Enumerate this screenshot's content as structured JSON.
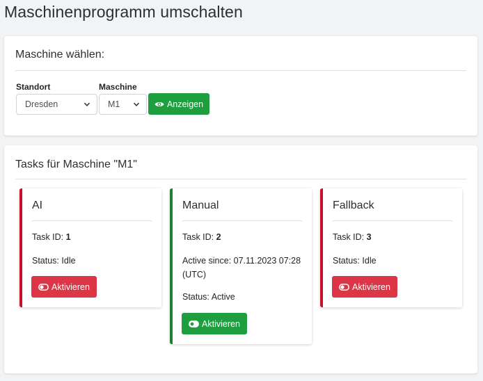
{
  "page": {
    "title": "Maschinenprogramm umschalten"
  },
  "selection": {
    "heading": "Maschine wählen:",
    "location_label": "Standort",
    "location_value": "Dresden",
    "machine_label": "Maschine",
    "machine_value": "M1",
    "show_button": "Anzeigen"
  },
  "tasks": {
    "heading": "Tasks für Maschine \"M1\"",
    "task_id_label": "Task ID:",
    "status_label": "Status:",
    "items": [
      {
        "name": "AI",
        "id": "1",
        "status": "Idle",
        "active_since": "",
        "button": "Aktivieren"
      },
      {
        "name": "Manual",
        "id": "2",
        "status": "Active",
        "active_since": "Active since: 07.11.2023 07:28 (UTC)",
        "button": "Aktivieren"
      },
      {
        "name": "Fallback",
        "id": "3",
        "status": "Idle",
        "active_since": "",
        "button": "Aktivieren"
      }
    ]
  },
  "colors": {
    "success": "#1e9e3f",
    "danger": "#dc3545",
    "active_border": "#1e7e34",
    "idle_border": "#c8102e"
  }
}
